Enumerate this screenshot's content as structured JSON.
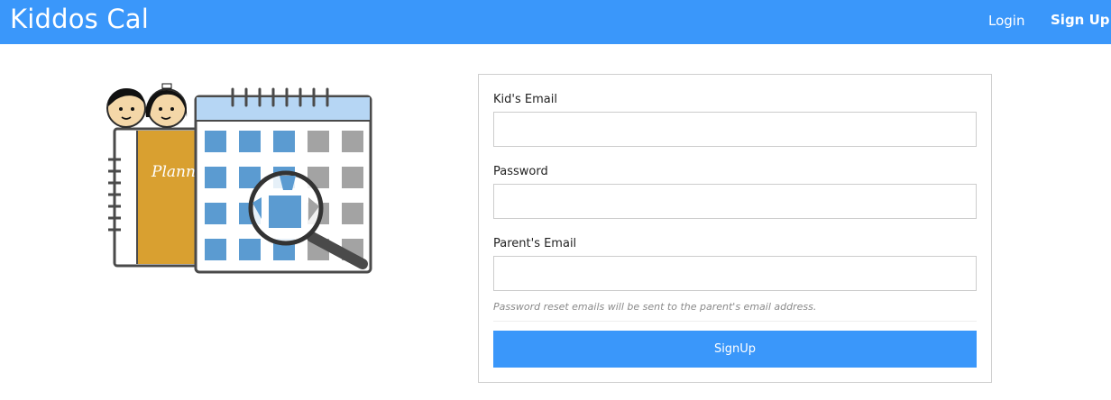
{
  "navbar": {
    "brand": "Kiddos Cal",
    "login_label": "Login",
    "signup_label": "Sign Up",
    "color": "#3a97fa"
  },
  "illustration": {
    "planner_text": "Plann",
    "icons": [
      "kids-faces-icon",
      "planner-notebook-icon",
      "calendar-icon",
      "magnifying-glass-icon"
    ]
  },
  "form": {
    "kid_email_label": "Kid's Email",
    "kid_email_value": "",
    "password_label": "Password",
    "password_value": "",
    "parent_email_label": "Parent's Email",
    "parent_email_value": "",
    "help_text": "Password reset emails will be sent to the parent's email address.",
    "submit_label": "SignUp"
  }
}
